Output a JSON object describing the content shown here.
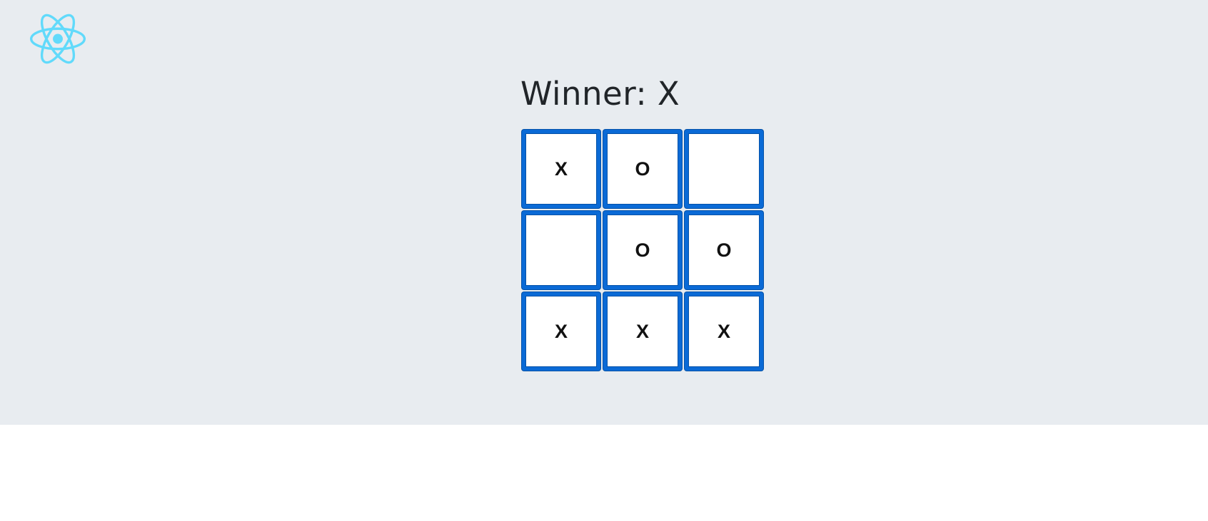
{
  "logo": {
    "icon": "react-atom-icon",
    "color": "#61dafb"
  },
  "status": "Winner: X",
  "board": {
    "squares": [
      "X",
      "O",
      "",
      "",
      "O",
      "O",
      "X",
      "X",
      "X"
    ]
  },
  "colors": {
    "background": "#e8ecf0",
    "square_border": "#0a6ad6"
  }
}
